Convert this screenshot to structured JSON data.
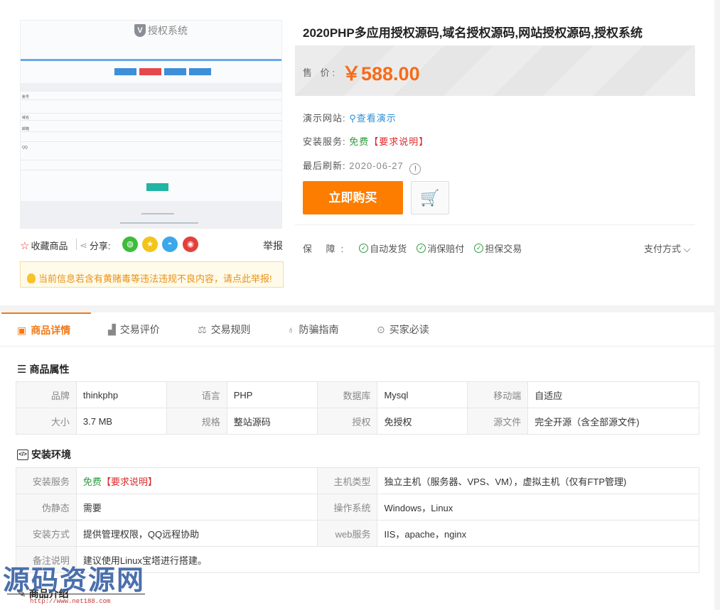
{
  "preview": {
    "logo_letter": "V",
    "logo_text": "授权系统",
    "labels": [
      "账号",
      "域名",
      "邮箱",
      "QQ"
    ]
  },
  "left": {
    "favorite": "收藏商品",
    "share": "分享:",
    "share_icons": [
      "wechat-icon",
      "qzone-icon",
      "qq-icon",
      "weibo-icon"
    ],
    "report": "举报",
    "notice": "当前信息若含有黄赌毒等违法违规不良内容，请点此举报!"
  },
  "product": {
    "title": "2020PHP多应用授权源码,域名授权源码,网站授权源码,授权系统",
    "price_label": "售 价:",
    "price": "￥588.00",
    "demo_label": "演示网站:",
    "demo_link": "查看演示",
    "install_label": "安装服务:",
    "install_free": "免费",
    "install_req": "【要求说明】",
    "refresh_label": "最后刷新:",
    "refresh_date": "2020-06-27",
    "buy_button": "立即购买",
    "guarantee_label": "保 障:",
    "guarantees": [
      "自动发货",
      "消保赔付",
      "担保交易"
    ],
    "pay_mode": "支付方式"
  },
  "tabs": [
    {
      "label": "商品详情",
      "icon": "image-icon",
      "active": true
    },
    {
      "label": "交易评价",
      "icon": "thumbs-up-icon",
      "active": false
    },
    {
      "label": "交易规则",
      "icon": "scale-icon",
      "active": false
    },
    {
      "label": "防骗指南",
      "icon": "lightbulb-icon",
      "active": false
    },
    {
      "label": "买家必读",
      "icon": "target-icon",
      "active": false
    }
  ],
  "attributes": {
    "title": "商品属性",
    "rows": [
      [
        [
          "品牌",
          "thinkphp"
        ],
        [
          "语言",
          "PHP"
        ],
        [
          "数据库",
          "Mysql"
        ],
        [
          "移动端",
          "自适应"
        ]
      ],
      [
        [
          "大小",
          "3.7 MB"
        ],
        [
          "规格",
          "整站源码"
        ],
        [
          "授权",
          "免授权"
        ],
        [
          "源文件",
          "完全开源（含全部源文件)"
        ]
      ]
    ]
  },
  "environment": {
    "title": "安装环境",
    "install_key": "安装服务",
    "install_free": "免费",
    "install_req": "【要求说明】",
    "host_key": "主机类型",
    "host_val": "独立主机（服务器、VPS、VM），虚拟主机（仅有FTP管理)",
    "rewrite_key": "伪静态",
    "rewrite_val": "需要",
    "os_key": "操作系统",
    "os_val": "Windows，Linux",
    "method_key": "安装方式",
    "method_val": "提供管理权限，QQ远程协助",
    "web_key": "web服务",
    "web_val": "IIS，apache，nginx",
    "note_key": "备注说明",
    "note_val": "建议使用Linux宝塔进行搭建。"
  },
  "intro": {
    "title": "商品介绍"
  },
  "watermark": {
    "text": "源码资源网",
    "url": "http://www.net188.com"
  }
}
